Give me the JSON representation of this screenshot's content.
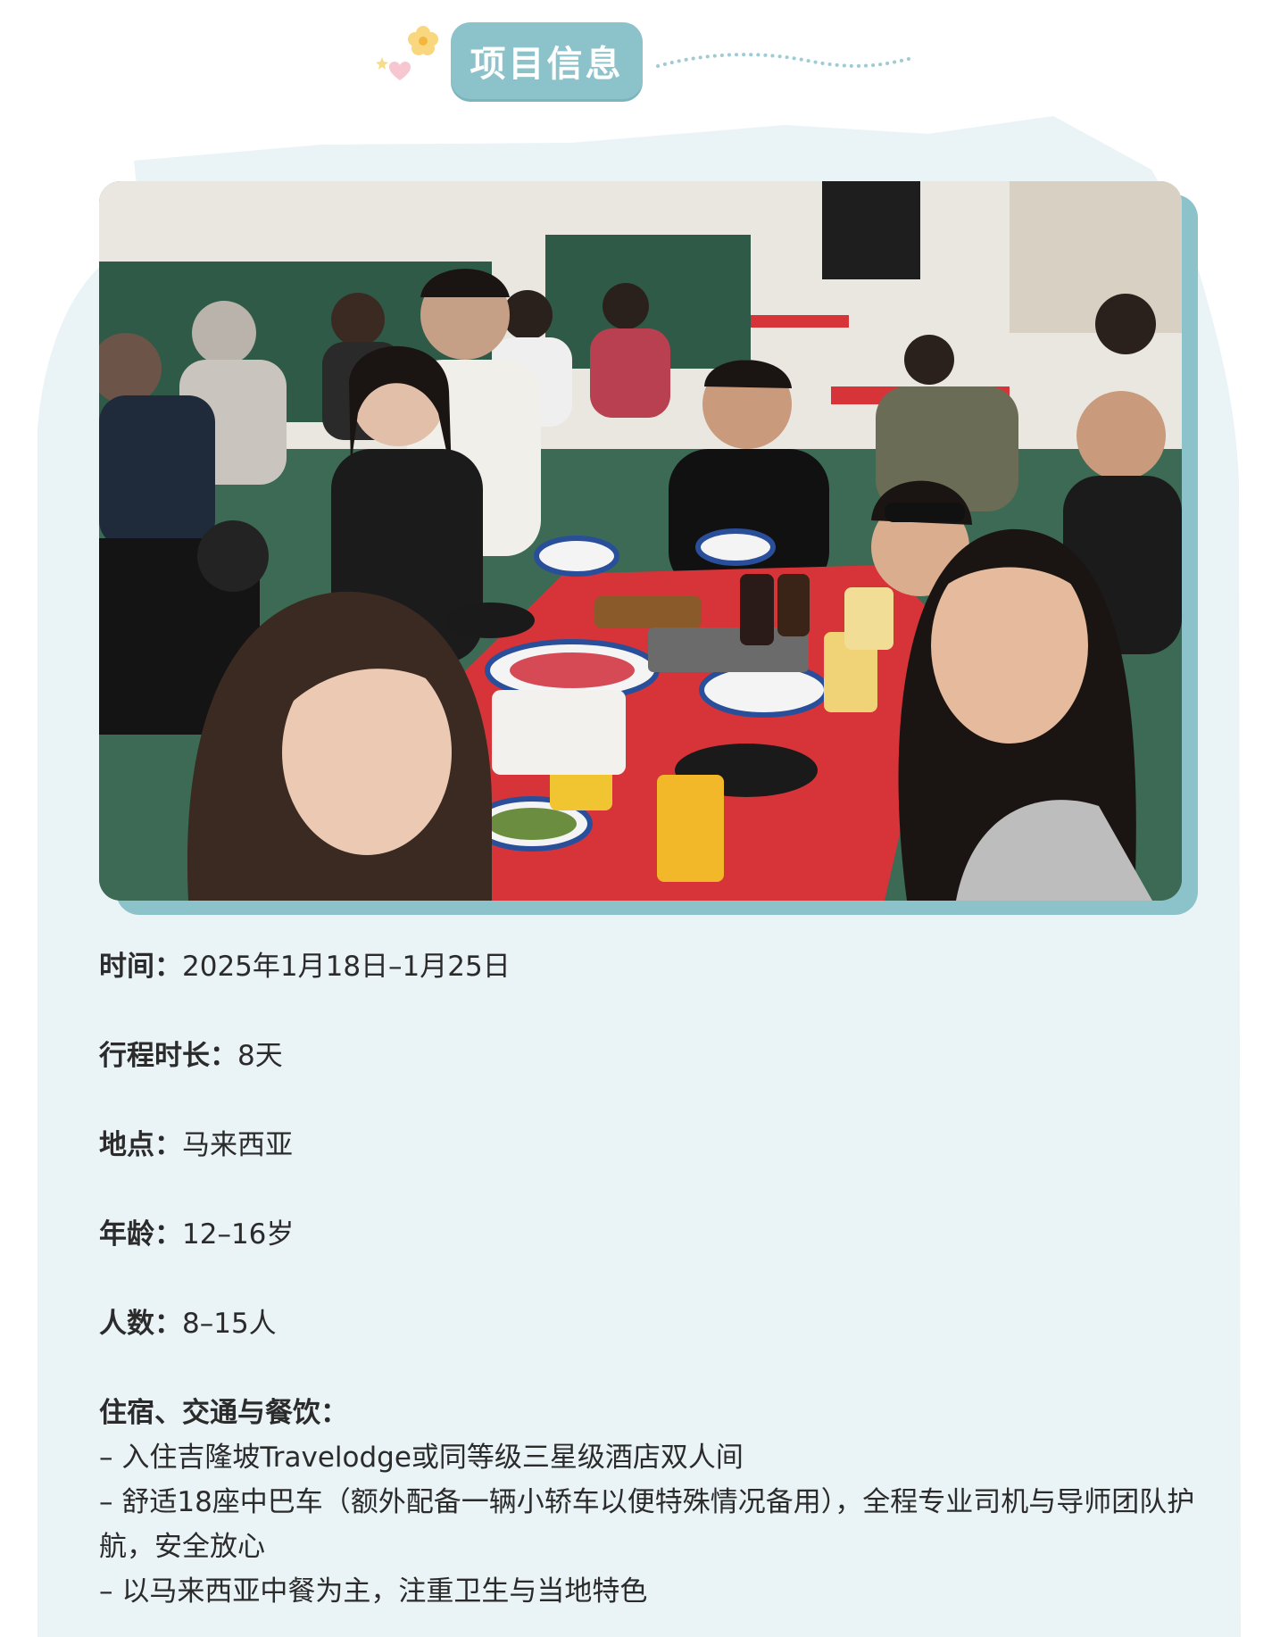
{
  "header": {
    "title": "项目信息"
  },
  "photo": {
    "icon": "group-photo-image"
  },
  "info": [
    {
      "label": "时间：",
      "value": "2025年1月18日–1月25日"
    },
    {
      "label": "行程时长：",
      "value": "8天"
    },
    {
      "label": "地点：",
      "value": "马来西亚"
    },
    {
      "label": "年龄：",
      "value": "12–16岁"
    },
    {
      "label": "人数：",
      "value": "8–15人"
    }
  ],
  "stay": {
    "label": "住宿、交通与餐饮：",
    "lines": [
      "– 入住吉隆坡Travelodge或同等级三星级酒店双人间",
      "– 舒适18座中巴车（额外配备一辆小轿车以便特殊情况备用），全程专业司机与导师团队护航，安全放心",
      "– 以马来西亚中餐为主，注重卫生与当地特色"
    ]
  },
  "colors": {
    "accent": "#8cc2ca",
    "panel": "#eaf3f6",
    "text": "#2b2b2b"
  }
}
